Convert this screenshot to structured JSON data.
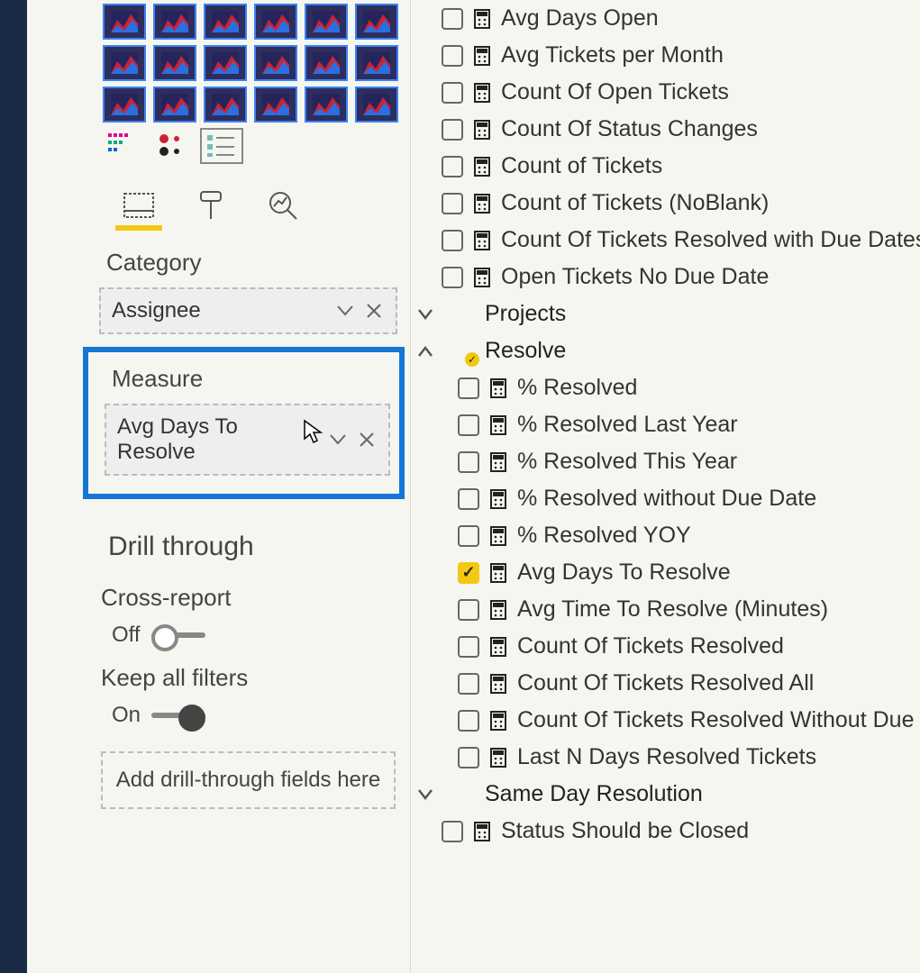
{
  "viz": {
    "tabs": [
      "fields",
      "format",
      "analytics"
    ],
    "category_label": "Category",
    "category_value": "Assignee",
    "measure_label": "Measure",
    "measure_value": "Avg Days To Resolve",
    "drillthrough_heading": "Drill through",
    "cross_report_label": "Cross-report",
    "cross_report_value": "Off",
    "keep_filters_label": "Keep all filters",
    "keep_filters_value": "On",
    "drop_placeholder": "Add drill-through fields here"
  },
  "fields": {
    "top_measures": [
      "Avg Days Open",
      "Avg Tickets per Month",
      "Count Of Open Tickets",
      "Count Of Status Changes",
      "Count of Tickets",
      "Count of Tickets (NoBlank)",
      "Count Of Tickets Resolved with Due Dates",
      "Open Tickets No Due Date"
    ],
    "tables": [
      {
        "name": "Projects",
        "expanded": false
      },
      {
        "name": "Resolve",
        "expanded": true,
        "badge": true,
        "measures": [
          {
            "name": "% Resolved",
            "checked": false
          },
          {
            "name": "% Resolved Last Year",
            "checked": false
          },
          {
            "name": "% Resolved This Year",
            "checked": false
          },
          {
            "name": "% Resolved without Due Date",
            "checked": false
          },
          {
            "name": "% Resolved YOY",
            "checked": false
          },
          {
            "name": "Avg Days To Resolve",
            "checked": true
          },
          {
            "name": "Avg Time To Resolve (Minutes)",
            "checked": false
          },
          {
            "name": "Count Of Tickets Resolved",
            "checked": false
          },
          {
            "name": "Count Of Tickets Resolved All",
            "checked": false
          },
          {
            "name": "Count Of Tickets Resolved Without Due",
            "checked": false
          },
          {
            "name": "Last N Days Resolved Tickets",
            "checked": false
          }
        ]
      },
      {
        "name": "Same Day Resolution",
        "expanded": false
      }
    ],
    "trailing": [
      {
        "name": "Status Should be Closed",
        "checked": false
      }
    ]
  }
}
